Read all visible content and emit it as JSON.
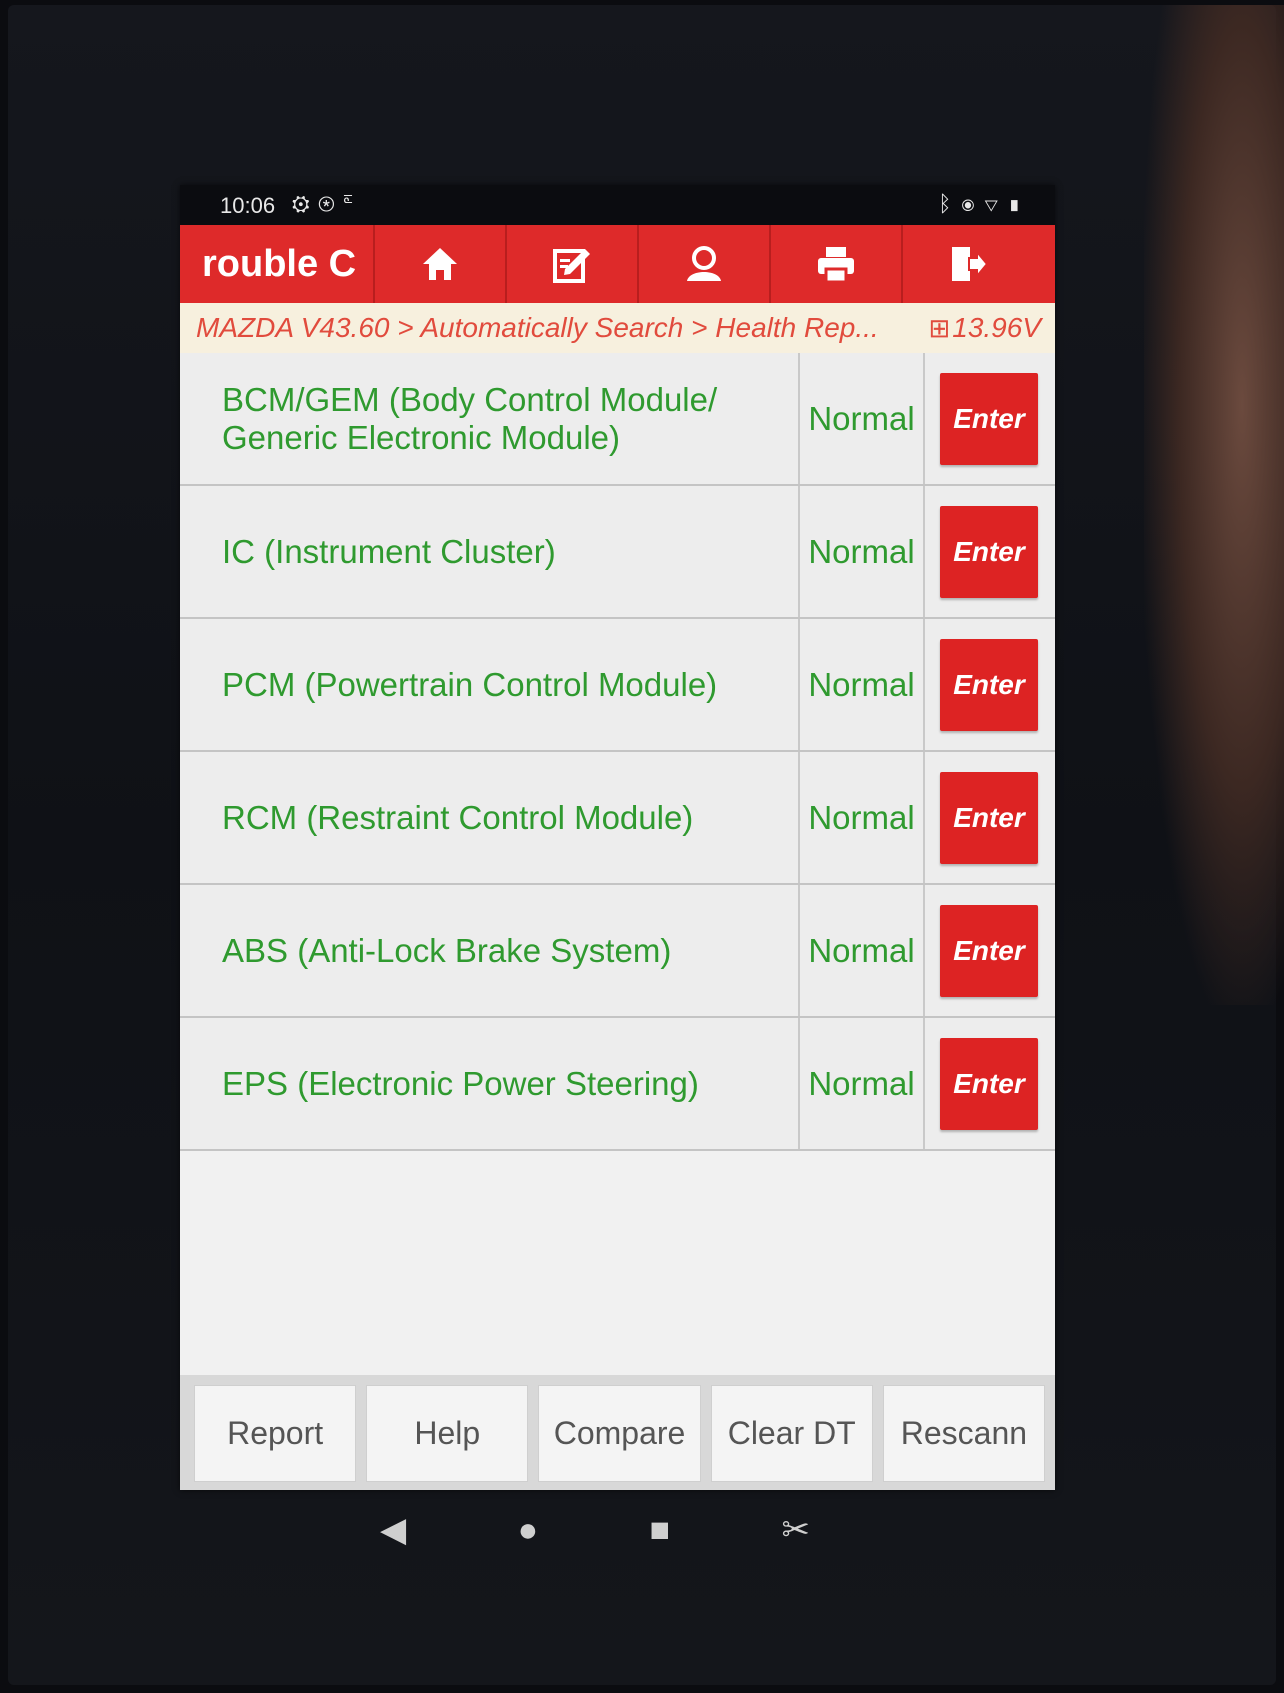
{
  "status_bar": {
    "time": "10:06",
    "left_icons": [
      "gear-icon",
      "accessibility-icon",
      "diagnostic-icon"
    ],
    "right_icons": [
      "bluetooth-icon",
      "location-icon",
      "signal-icon",
      "battery-icon"
    ]
  },
  "toolbar": {
    "title": "rouble C",
    "buttons": [
      "home-icon",
      "edit-icon",
      "user-icon",
      "print-icon",
      "exit-icon"
    ]
  },
  "breadcrumb": {
    "path": "MAZDA V43.60 > Automatically Search > Health Rep...",
    "voltage": "13.96V"
  },
  "modules": [
    {
      "name": "BCM/GEM (Body Control Module/ Generic Electronic Module)",
      "status": "Normal",
      "action": "Enter"
    },
    {
      "name": "IC (Instrument Cluster)",
      "status": "Normal",
      "action": "Enter"
    },
    {
      "name": "PCM (Powertrain Control Module)",
      "status": "Normal",
      "action": "Enter"
    },
    {
      "name": "RCM (Restraint Control Module)",
      "status": "Normal",
      "action": "Enter"
    },
    {
      "name": "ABS (Anti-Lock Brake System)",
      "status": "Normal",
      "action": "Enter"
    },
    {
      "name": "EPS (Electronic Power Steering)",
      "status": "Normal",
      "action": "Enter"
    }
  ],
  "footer": {
    "report": "Report",
    "help": "Help",
    "compare": "Compare",
    "clear_dtc": "Clear DT",
    "rescan": "Rescann"
  },
  "colors": {
    "accent_red": "#de2a2a",
    "module_text_green": "#2f9a2f",
    "breadcrumb_text": "#e14b3d"
  }
}
